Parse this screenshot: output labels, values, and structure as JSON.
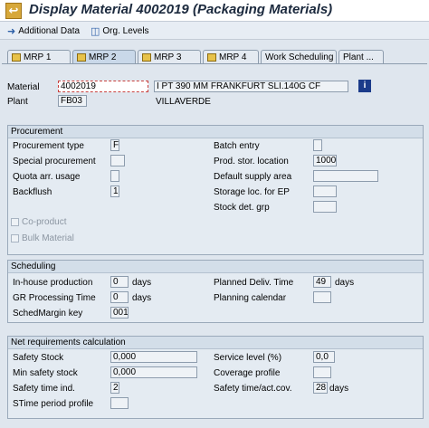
{
  "title": "Display Material 4002019 (Packaging Materials)",
  "toolbar": {
    "additional_data": "Additional Data",
    "org_levels": "Org. Levels"
  },
  "tabs": [
    "MRP 1",
    "MRP 2",
    "MRP 3",
    "MRP 4",
    "Work Scheduling",
    "Plant ..."
  ],
  "header": {
    "material_label": "Material",
    "material_value": "4002019",
    "material_desc": "I PT 390 MM FRANKFURT SLI.140G CF",
    "plant_label": "Plant",
    "plant_value": "FB03",
    "plant_desc": "VILLAVERDE"
  },
  "procurement": {
    "title": "Procurement",
    "procurement_type_label": "Procurement type",
    "procurement_type_value": "F",
    "special_procurement_label": "Special procurement",
    "special_procurement_value": "",
    "quota_label": "Quota arr. usage",
    "quota_value": "",
    "backflush_label": "Backflush",
    "backflush_value": "1",
    "coproduct_label": "Co-product",
    "bulk_material_label": "Bulk Material",
    "batch_entry_label": "Batch entry",
    "batch_entry_value": "",
    "prod_stor_loc_label": "Prod. stor. location",
    "prod_stor_loc_value": "1000",
    "default_supply_area_label": "Default supply area",
    "default_supply_area_value": "",
    "storage_loc_ep_label": "Storage loc. for EP",
    "storage_loc_ep_value": "",
    "stock_det_grp_label": "Stock det. grp",
    "stock_det_grp_value": ""
  },
  "scheduling": {
    "title": "Scheduling",
    "inhouse_label": "In-house production",
    "inhouse_value": "0",
    "inhouse_unit": "days",
    "gr_label": "GR Processing Time",
    "gr_value": "0",
    "gr_unit": "days",
    "schedmargin_label": "SchedMargin key",
    "schedmargin_value": "001",
    "planned_deliv_label": "Planned Deliv. Time",
    "planned_deliv_value": "49",
    "planned_deliv_unit": "days",
    "planning_calendar_label": "Planning calendar",
    "planning_calendar_value": ""
  },
  "net_requirements": {
    "title": "Net requirements calculation",
    "safety_stock_label": "Safety Stock",
    "safety_stock_value": "0,000",
    "min_safety_stock_label": "Min safety stock",
    "min_safety_stock_value": "0,000",
    "safety_time_ind_label": "Safety time ind.",
    "safety_time_ind_value": "2",
    "stime_period_label": "STime period profile",
    "stime_period_value": "",
    "service_level_label": "Service level (%)",
    "service_level_value": "0,0",
    "coverage_profile_label": "Coverage profile",
    "coverage_profile_value": "",
    "safety_time_actcov_label": "Safety time/act.cov.",
    "safety_time_actcov_value": "28",
    "safety_time_actcov_unit": "days"
  },
  "colors": {
    "background": "#dfe6ee",
    "group_header": "#d3dee9",
    "title_text": "#1c2a3e",
    "info_button": "#1b3b8a",
    "back_icon": "#d7a83a"
  },
  "icons": {
    "back": "back-arrow-icon",
    "additional_data": "arrow-right-icon",
    "org_levels": "org-levels-icon",
    "info": "info-icon",
    "tab": "tab-folder-icon"
  }
}
